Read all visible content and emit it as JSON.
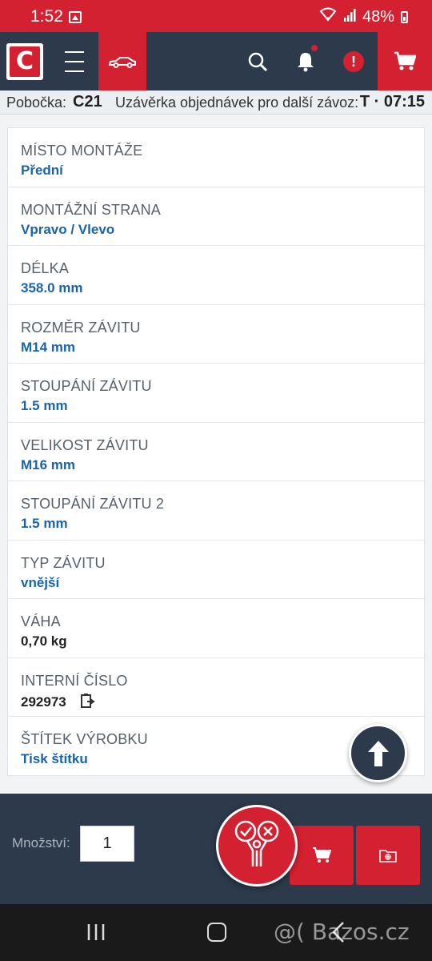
{
  "status_bar": {
    "time": "1:52",
    "battery": "48%",
    "icons": [
      "image-icon",
      "wifi-icon",
      "signal-icon",
      "battery-icon"
    ]
  },
  "header": {
    "logo_letter": "C",
    "icons": [
      "logo-icon",
      "menu-icon",
      "car-icon",
      "search-icon",
      "bell-icon",
      "alert-icon",
      "cart-icon"
    ],
    "alert_symbol": "!",
    "colors": {
      "header_bg": "#2c3a4b",
      "accent": "#d42132"
    }
  },
  "info_bar": {
    "branch_label": "Pobočka:",
    "branch_value": "C21",
    "deadline_label": "Uzávěrka objednávek pro další závoz:",
    "deadline_value": "T · 07:15"
  },
  "attributes": [
    {
      "label": "MÍSTO MONTÁŽE",
      "value": "Přední"
    },
    {
      "label": "MONTÁŽNÍ STRANA",
      "value": "Vpravo / Vlevo"
    },
    {
      "label": "DÉLKA",
      "value": "358.0 mm"
    },
    {
      "label": "ROZMĚR ZÁVITU",
      "value": "M14 mm"
    },
    {
      "label": "STOUPÁNÍ ZÁVITU",
      "value": "1.5 mm"
    },
    {
      "label": "VELIKOST ZÁVITU",
      "value": "M16 mm"
    },
    {
      "label": "STOUPÁNÍ ZÁVITU 2",
      "value": "1.5 mm"
    },
    {
      "label": "TYP ZÁVITU",
      "value": "vnější"
    },
    {
      "label": "VÁHA",
      "value": "0,70 kg"
    },
    {
      "label": "INTERNÍ ČÍSLO",
      "value": "292973"
    },
    {
      "label": "ŠTÍTEK VÝROBKU",
      "value": "Tisk štítku"
    }
  ],
  "bottom_bar": {
    "quantity_label": "Množství:",
    "quantity_value": "1",
    "icons": [
      "compatibility-icon",
      "add-to-cart-icon",
      "folder-icon"
    ]
  },
  "nav_bar": {
    "icons": [
      "recent-apps-icon",
      "home-icon",
      "back-icon"
    ],
    "watermark": "@( Bazos.cz"
  }
}
